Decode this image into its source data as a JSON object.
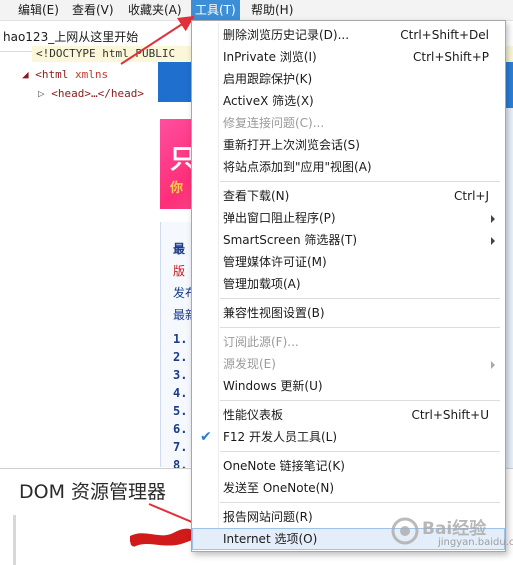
{
  "menubar": {
    "items": [
      {
        "label": "编辑(E)"
      },
      {
        "label": "查看(V)"
      },
      {
        "label": "收藏夹(A)"
      },
      {
        "label": "工具(T)"
      },
      {
        "label": "帮助(H)"
      }
    ],
    "active_index": 3
  },
  "favorites": {
    "link_label": "hao123_上网从这里开始"
  },
  "page_content": {
    "banner_text": "只",
    "banner_sub": "你",
    "headline": "最",
    "line_red": "版",
    "line2": "发布",
    "line3": "最新",
    "numbers": [
      "1.",
      "2.",
      "3.",
      "4.",
      "5.",
      "6.",
      "7.",
      "8."
    ]
  },
  "devtools": {
    "title": "DOM 资源管理器",
    "doctype_line": "<!DOCTYPE html PUBLIC",
    "html_tag": "<html",
    "html_attr": "xmlns",
    "head_line": "<head>…</head>"
  },
  "tools_menu": {
    "groups": [
      [
        {
          "label": "删除浏览历史记录(D)...",
          "shortcut": "Ctrl+Shift+Del",
          "disabled": false
        },
        {
          "label": "InPrivate 浏览(I)",
          "shortcut": "Ctrl+Shift+P",
          "disabled": false
        },
        {
          "label": "启用跟踪保护(K)",
          "shortcut": "",
          "disabled": false
        },
        {
          "label": "ActiveX 筛选(X)",
          "shortcut": "",
          "disabled": false
        },
        {
          "label": "修复连接问题(C)...",
          "shortcut": "",
          "disabled": true
        },
        {
          "label": "重新打开上次浏览会话(S)",
          "shortcut": "",
          "disabled": false
        },
        {
          "label": "将站点添加到\"应用\"视图(A)",
          "shortcut": "",
          "disabled": false
        }
      ],
      [
        {
          "label": "查看下载(N)",
          "shortcut": "Ctrl+J",
          "disabled": false
        },
        {
          "label": "弹出窗口阻止程序(P)",
          "shortcut": "",
          "submenu": true,
          "disabled": false
        },
        {
          "label": "SmartScreen 筛选器(T)",
          "shortcut": "",
          "submenu": true,
          "disabled": false
        },
        {
          "label": "管理媒体许可证(M)",
          "shortcut": "",
          "disabled": false
        },
        {
          "label": "管理加载项(A)",
          "shortcut": "",
          "disabled": false
        }
      ],
      [
        {
          "label": "兼容性视图设置(B)",
          "shortcut": "",
          "disabled": false
        }
      ],
      [
        {
          "label": "订阅此源(F)...",
          "shortcut": "",
          "disabled": true
        },
        {
          "label": "源发现(E)",
          "shortcut": "",
          "submenu": true,
          "disabled": true
        },
        {
          "label": "Windows 更新(U)",
          "shortcut": "",
          "disabled": false
        }
      ],
      [
        {
          "label": "性能仪表板",
          "shortcut": "Ctrl+Shift+U",
          "disabled": false
        },
        {
          "label": "F12 开发人员工具(L)",
          "shortcut": "",
          "checked": true,
          "disabled": false
        }
      ],
      [
        {
          "label": "OneNote 链接笔记(K)",
          "shortcut": "",
          "disabled": false
        },
        {
          "label": "发送至 OneNote(N)",
          "shortcut": "",
          "disabled": false
        }
      ],
      [
        {
          "label": "报告网站问题(R)",
          "shortcut": "",
          "disabled": false
        },
        {
          "label": "Internet 选项(O)",
          "shortcut": "",
          "disabled": false,
          "highlighted": true
        }
      ]
    ]
  },
  "watermark": {
    "text": "Bai经验",
    "sub": "jingyan.baidu.com"
  },
  "colors": {
    "menu_active": "#3c8fd6",
    "annotation_arrow": "#e0303a",
    "highlight_bg": "#e3eefa",
    "check": "#2a7ad2"
  },
  "icons": [
    "checkmark-icon",
    "submenu-arrow-icon",
    "annotation-arrow-icon"
  ]
}
